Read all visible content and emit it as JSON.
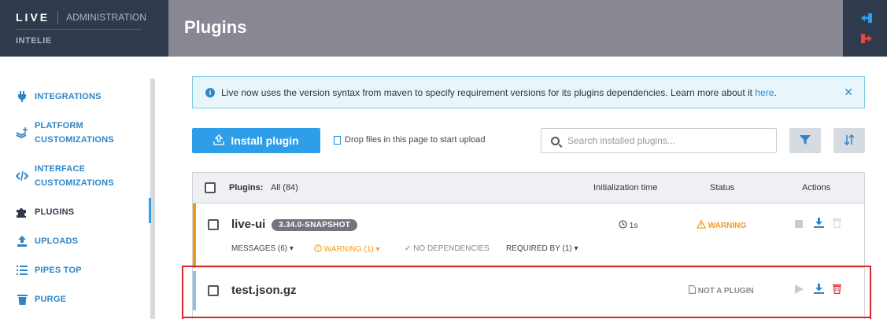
{
  "brand": {
    "logo": "LIVE",
    "section": "ADMINISTRATION",
    "org": "INTELIE"
  },
  "sidebar": {
    "items": [
      {
        "label": "INTEGRATIONS",
        "icon": "plug-icon",
        "glyph": "⚡"
      },
      {
        "label": "PLATFORM\nCUSTOMIZATIONS",
        "icon": "layers-plus-icon",
        "glyph": "≋"
      },
      {
        "label": "INTERFACE\nCUSTOMIZATIONS",
        "icon": "code-icon",
        "glyph": "</>"
      },
      {
        "label": "PLUGINS",
        "icon": "puzzle-icon",
        "glyph": "✚"
      },
      {
        "label": "UPLOADS",
        "icon": "upload-icon",
        "glyph": "⇪"
      },
      {
        "label": "PIPES TOP",
        "icon": "list-icon",
        "glyph": "☰"
      },
      {
        "label": "PURGE",
        "icon": "trash-icon",
        "glyph": "▬"
      }
    ]
  },
  "header": {
    "title": "Plugins"
  },
  "alert": {
    "text": "Live now uses the version syntax from maven to specify requirement versions for its plugins dependencies. Learn more about it ",
    "link": "here",
    "suffix": "."
  },
  "toolbar": {
    "install_label": "Install plugin",
    "drop_hint": "Drop files in this page to start upload",
    "search_placeholder": "Search installed plugins..."
  },
  "table": {
    "header": {
      "plugins": "Plugins:",
      "filter": "All (84)",
      "init_time": "Initialization time",
      "status": "Status",
      "actions": "Actions"
    },
    "rows": [
      {
        "name": "live-ui",
        "version": "3.34.0-SNAPSHOT",
        "init_time": "1s",
        "status": "WARNING",
        "messages": "MESSAGES (6)",
        "warnings": "WARNING (1)",
        "dependencies": "NO DEPENDENCIES",
        "required_by": "REQUIRED BY (1)"
      },
      {
        "name": "test.json.gz",
        "status": "NOT A PLUGIN"
      }
    ]
  },
  "colors": {
    "accent": "#2e9ee8",
    "warning": "#f39c12",
    "danger": "#d9262c",
    "header": "#878892",
    "sidebar_dark": "#2f3b4c"
  }
}
